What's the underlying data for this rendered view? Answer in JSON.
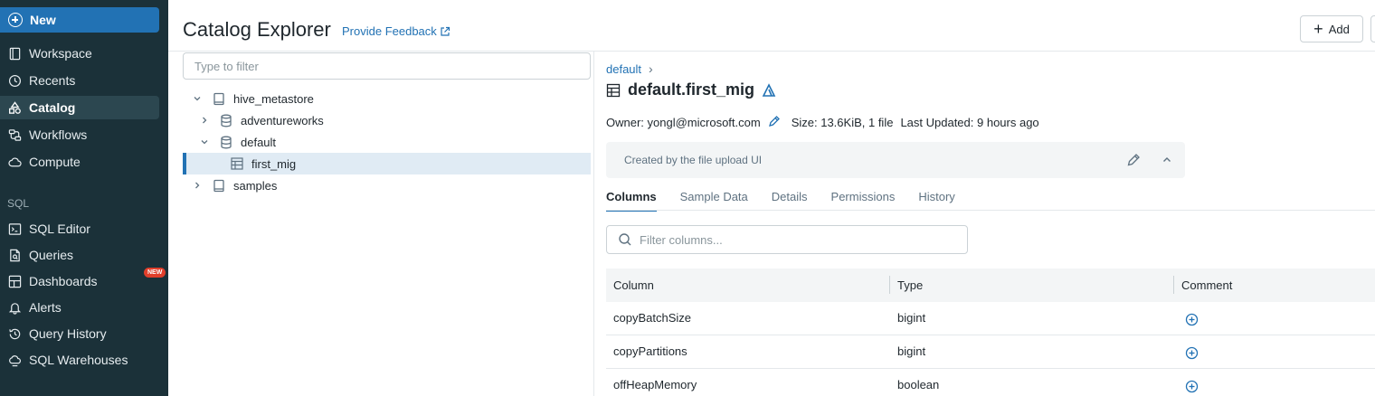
{
  "sidebar": {
    "new_label": "New",
    "items": [
      {
        "label": "Workspace",
        "icon": "workspace-icon"
      },
      {
        "label": "Recents",
        "icon": "clock-icon"
      },
      {
        "label": "Catalog",
        "icon": "catalog-icon",
        "active": true
      },
      {
        "label": "Workflows",
        "icon": "workflows-icon"
      },
      {
        "label": "Compute",
        "icon": "cloud-icon"
      }
    ],
    "sql_section_label": "SQL",
    "sql_items": [
      {
        "label": "SQL Editor",
        "icon": "sql-editor-icon"
      },
      {
        "label": "Queries",
        "icon": "queries-icon"
      },
      {
        "label": "Dashboards",
        "icon": "dashboards-icon",
        "badge": "NEW"
      },
      {
        "label": "Alerts",
        "icon": "bell-icon"
      },
      {
        "label": "Query History",
        "icon": "history-icon"
      },
      {
        "label": "SQL Warehouses",
        "icon": "warehouse-icon"
      }
    ]
  },
  "header": {
    "title": "Catalog Explorer",
    "feedback_link": "Provide Feedback",
    "add_label": "Add"
  },
  "tree": {
    "filter_placeholder": "Type to filter",
    "nodes": [
      {
        "label": "hive_metastore",
        "type": "catalog",
        "expanded": true
      },
      {
        "label": "adventureworks",
        "type": "schema",
        "expanded": false
      },
      {
        "label": "default",
        "type": "schema",
        "expanded": true
      },
      {
        "label": "first_mig",
        "type": "table",
        "selected": true
      },
      {
        "label": "samples",
        "type": "catalog",
        "expanded": false
      }
    ]
  },
  "detail": {
    "breadcrumb": "default",
    "breadcrumb_sep": "›",
    "title": "default.first_mig",
    "owner": "Owner: yongl@microsoft.com",
    "size": "Size: 13.6KiB, 1 file",
    "last_updated": "Last Updated: 9 hours ago",
    "description": "Created by the file upload UI",
    "tabs": [
      "Columns",
      "Sample Data",
      "Details",
      "Permissions",
      "History"
    ],
    "active_tab": "Columns",
    "column_filter_placeholder": "Filter columns...",
    "table": {
      "headers": [
        "Column",
        "Type",
        "Comment"
      ],
      "rows": [
        {
          "column": "copyBatchSize",
          "type": "bigint"
        },
        {
          "column": "copyPartitions",
          "type": "bigint"
        },
        {
          "column": "offHeapMemory",
          "type": "boolean"
        }
      ]
    }
  },
  "colors": {
    "sidebar_bg": "#1b3139",
    "accent": "#2272b4",
    "badge": "#e13f2b"
  }
}
